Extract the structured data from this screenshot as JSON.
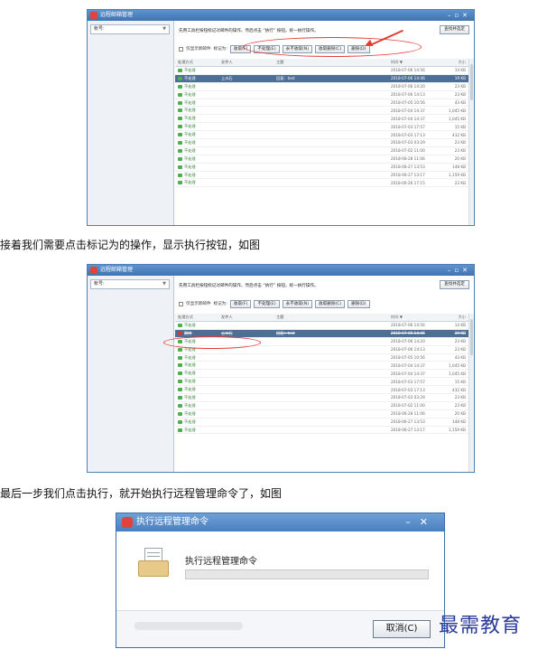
{
  "windows": [
    {
      "title": "远程邮箱管理",
      "account_label": "帐号:",
      "tip": "先用工具栏按钮标记对邮件的操作，然后点击 “执行” 按钮，统一执行操作。",
      "find_button": "查找并选定",
      "checkbox_label": "仅显示新邮件",
      "mark_label": "标记为:",
      "buttons": [
        "收取(F)",
        "不处理(E)",
        "永不收取(N)",
        "收取删除(C)",
        "删除(D)"
      ],
      "columns": [
        "处理方式",
        "发件人",
        "主题",
        "时间 ▼",
        "大小"
      ],
      "rows": [
        {
          "action": "不处理",
          "sender": "",
          "subject": "",
          "time": "2018-07-06 14:56",
          "size": "14 KB"
        },
        {
          "action": "不处理",
          "sender": "上水石",
          "subject": "回复：test",
          "time": "2018-07-06 14:46",
          "size": "19 KB"
        },
        {
          "action": "不处理",
          "sender": "",
          "subject": "",
          "time": "2018-07-06 14:20",
          "size": "23 KB"
        },
        {
          "action": "不处理",
          "sender": "",
          "subject": "",
          "time": "2018-07-06 14:13",
          "size": "23 KB"
        },
        {
          "action": "不处理",
          "sender": "",
          "subject": "",
          "time": "2018-07-05 10:56",
          "size": "43 KB"
        },
        {
          "action": "不处理",
          "sender": "",
          "subject": "",
          "time": "2018-07-04 14:37",
          "size": "1,045 KB"
        },
        {
          "action": "不处理",
          "sender": "",
          "subject": "",
          "time": "2018-07-04 14:37",
          "size": "1,045 KB"
        },
        {
          "action": "不处理",
          "sender": "",
          "subject": "",
          "time": "2018-07-03 17:57",
          "size": "15 KB"
        },
        {
          "action": "不处理",
          "sender": "",
          "subject": "",
          "time": "2018-07-03 17:13",
          "size": "432 KB"
        },
        {
          "action": "不处理",
          "sender": "",
          "subject": "",
          "time": "2018-07-03 03:29",
          "size": "23 KB"
        },
        {
          "action": "不处理",
          "sender": "",
          "subject": "",
          "time": "2018-07-02 11:00",
          "size": "23 KB"
        },
        {
          "action": "不处理",
          "sender": "",
          "subject": "",
          "time": "2018-06-28 11:06",
          "size": "20 KB"
        },
        {
          "action": "不处理",
          "sender": "",
          "subject": "",
          "time": "2018-06-27 13:53",
          "size": "148 KB"
        },
        {
          "action": "不处理",
          "sender": "",
          "subject": "",
          "time": "2018-06-27 13:17",
          "size": "1,159 KB"
        },
        {
          "action": "不处理",
          "sender": "",
          "subject": "",
          "time": "2018-06-26 17:15",
          "size": "23 KB"
        }
      ]
    },
    {
      "title": "远程邮箱管理",
      "account_label": "帐号:",
      "tip": "先用工具栏按钮标记对邮件的操作，然后点击 “执行” 按钮，统一执行操作。",
      "find_button": "查找并选定",
      "checkbox_label": "仅显示新邮件",
      "mark_label": "标记为:",
      "buttons": [
        "收取(F)",
        "不处理(E)",
        "永不收取(N)",
        "收取删除(C)",
        "删除(D)"
      ],
      "columns": [
        "处理方式",
        "发件人",
        "主题",
        "时间 ▼",
        "大小"
      ],
      "rows": [
        {
          "action": "不处理",
          "sender": "",
          "subject": "",
          "time": "2018-07-06 14:56",
          "size": "14 KB"
        },
        {
          "action": "删除",
          "sender": "上水石",
          "subject": "回复：test",
          "time": "2018-07-06 14:46",
          "size": "19 KB"
        },
        {
          "action": "不处理",
          "sender": "",
          "subject": "",
          "time": "2018-07-06 14:20",
          "size": "23 KB"
        },
        {
          "action": "不处理",
          "sender": "",
          "subject": "",
          "time": "2018-07-06 14:13",
          "size": "23 KB"
        },
        {
          "action": "不处理",
          "sender": "",
          "subject": "",
          "time": "2018-07-05 10:56",
          "size": "43 KB"
        },
        {
          "action": "不处理",
          "sender": "",
          "subject": "",
          "time": "2018-07-04 14:37",
          "size": "1,045 KB"
        },
        {
          "action": "不处理",
          "sender": "",
          "subject": "",
          "time": "2018-07-04 14:37",
          "size": "1,045 KB"
        },
        {
          "action": "不处理",
          "sender": "",
          "subject": "",
          "time": "2018-07-03 17:57",
          "size": "15 KB"
        },
        {
          "action": "不处理",
          "sender": "",
          "subject": "",
          "time": "2018-07-03 17:13",
          "size": "432 KB"
        },
        {
          "action": "不处理",
          "sender": "",
          "subject": "",
          "time": "2018-07-03 03:29",
          "size": "23 KB"
        },
        {
          "action": "不处理",
          "sender": "",
          "subject": "",
          "time": "2018-07-02 11:00",
          "size": "23 KB"
        },
        {
          "action": "不处理",
          "sender": "",
          "subject": "",
          "time": "2018-06-28 11:06",
          "size": "20 KB"
        },
        {
          "action": "不处理",
          "sender": "",
          "subject": "",
          "time": "2018-06-27 13:53",
          "size": "148 KB"
        },
        {
          "action": "不处理",
          "sender": "",
          "subject": "",
          "time": "2018-06-27 13:17",
          "size": "1,159 KB"
        }
      ]
    }
  ],
  "captions": [
    "接着我们需要点击标记为的操作，显示执行按钮，如图",
    "最后一步我们点击执行，就开始执行远程管理命令了，如图"
  ],
  "dialog": {
    "title": "执行远程管理命令",
    "message": "执行远程管理命令",
    "cancel_label": "取消(C)",
    "progress": 0
  },
  "watermark": "最需教育",
  "icons": {
    "app": "app-logo-icon",
    "keep": "leaf-icon",
    "delete": "delete-icon",
    "tray": "inbox-tray-icon"
  },
  "colors": {
    "title_bar": "#3f74b3",
    "selected_row": "#4d6f96",
    "annotation": "#e53935",
    "watermark": "#2a3a9c"
  }
}
